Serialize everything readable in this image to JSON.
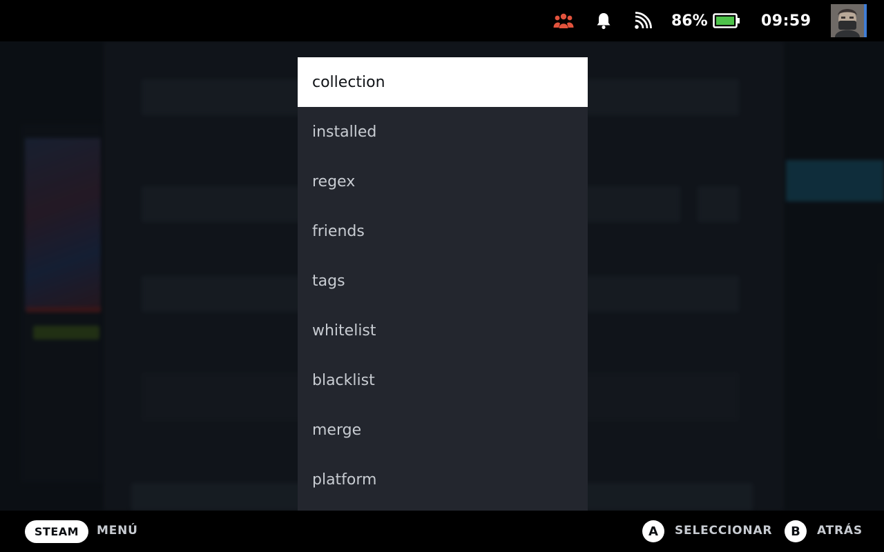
{
  "status_bar": {
    "battery_percent": "86%",
    "time": "09:59",
    "icons": [
      "friends-icon",
      "bell-icon",
      "wifi-icon",
      "battery-icon",
      "avatar"
    ],
    "friends_icon_color": "#e2533d",
    "battery_fill_color": "#4ec24a"
  },
  "dropdown": {
    "options": [
      {
        "label": "collection",
        "selected": true
      },
      {
        "label": "installed",
        "selected": false
      },
      {
        "label": "regex",
        "selected": false
      },
      {
        "label": "friends",
        "selected": false
      },
      {
        "label": "tags",
        "selected": false
      },
      {
        "label": "whitelist",
        "selected": false
      },
      {
        "label": "blacklist",
        "selected": false
      },
      {
        "label": "merge",
        "selected": false
      },
      {
        "label": "platform",
        "selected": false
      }
    ],
    "selected_bg": "#ffffff",
    "list_bg": "#23262e"
  },
  "footer": {
    "steam_label": "STEAM",
    "menu_label": "MENÚ",
    "a_button": "A",
    "select_label": "SELECCIONAR",
    "b_button": "B",
    "back_label": "ATRÁS"
  }
}
